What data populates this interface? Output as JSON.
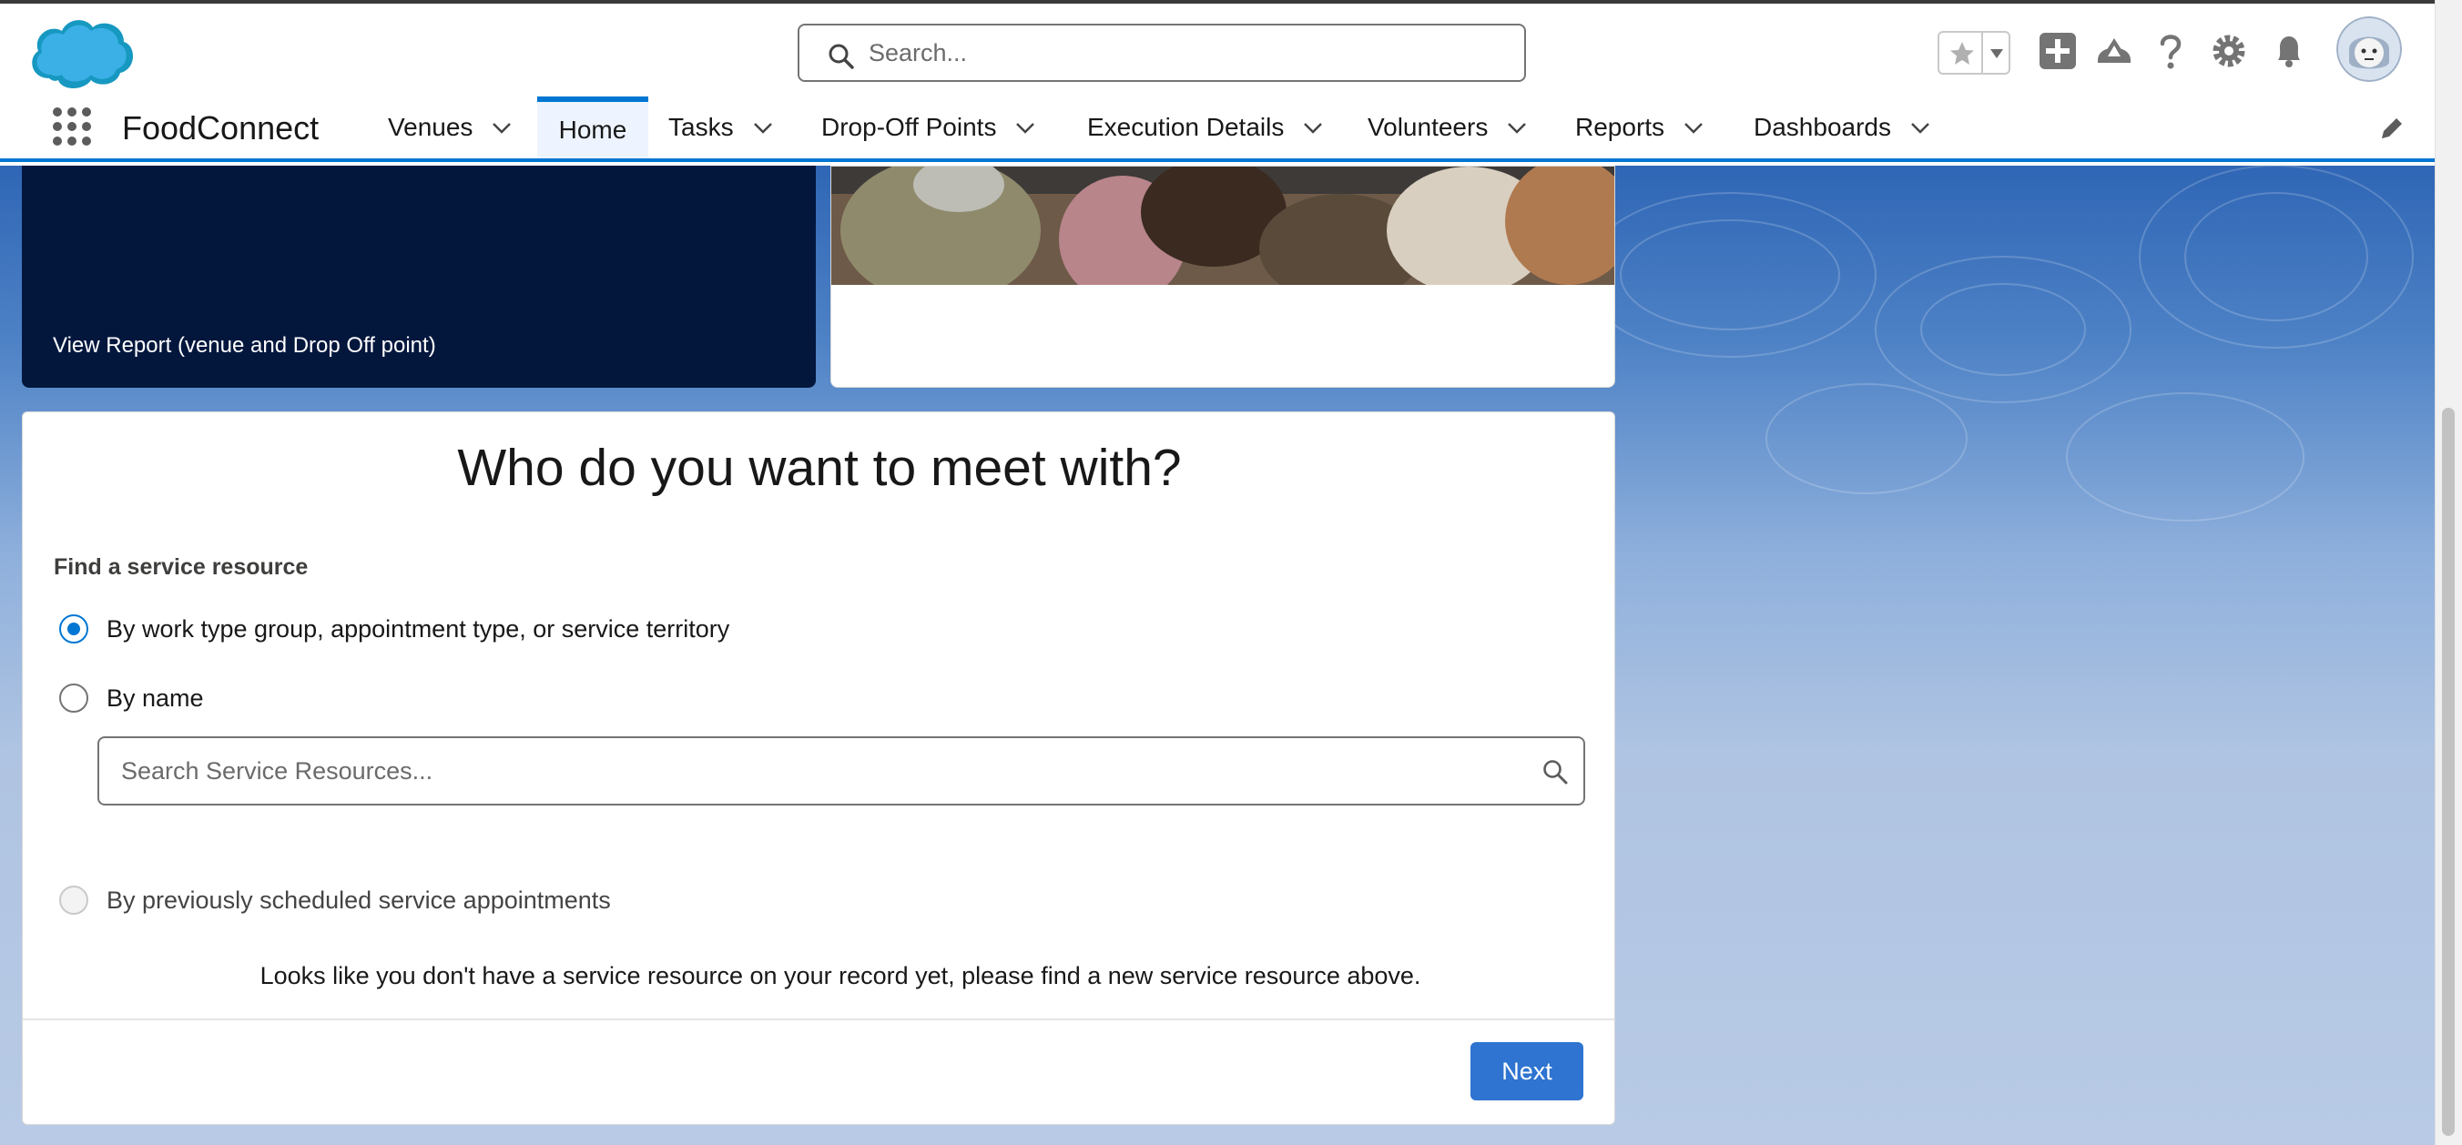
{
  "header": {
    "search_placeholder": "Search...",
    "icons": [
      "salesforce-cloud-logo",
      "favorites-star-icon",
      "favorites-dropdown-icon",
      "global-actions-add-icon",
      "trailhead-guidance-icon",
      "help-icon",
      "setup-gear-icon",
      "notifications-bell-icon",
      "user-avatar"
    ]
  },
  "nav": {
    "app_name": "FoodConnect",
    "items": [
      {
        "label": "Venues",
        "has_menu": true
      },
      {
        "label": "Home",
        "active": true
      },
      {
        "label": "Tasks",
        "has_menu": true
      },
      {
        "label": "Drop-Off Points",
        "has_menu": true
      },
      {
        "label": "Execution Details",
        "has_menu": true
      },
      {
        "label": "Volunteers",
        "has_menu": true
      },
      {
        "label": "Reports",
        "has_menu": true
      },
      {
        "label": "Dashboards",
        "has_menu": true
      }
    ]
  },
  "report_card": {
    "link_text": "View Report (venue and Drop Off point)"
  },
  "flow": {
    "title": "Who do you want to meet with?",
    "section_label": "Find a service resource",
    "options": [
      {
        "label": "By work type group, appointment type, or service territory",
        "checked": true,
        "disabled": false
      },
      {
        "label": "By name",
        "checked": false,
        "disabled": false
      },
      {
        "label": "By previously scheduled service appointments",
        "checked": false,
        "disabled": true
      }
    ],
    "resource_search_placeholder": "Search Service Resources...",
    "notice": "Looks like you don't have a service resource on your record yet, please find a new service resource above.",
    "next_label": "Next"
  },
  "colors": {
    "brand": "#0176d3",
    "dark_card": "#03173d",
    "next_button": "#2e74d0"
  }
}
